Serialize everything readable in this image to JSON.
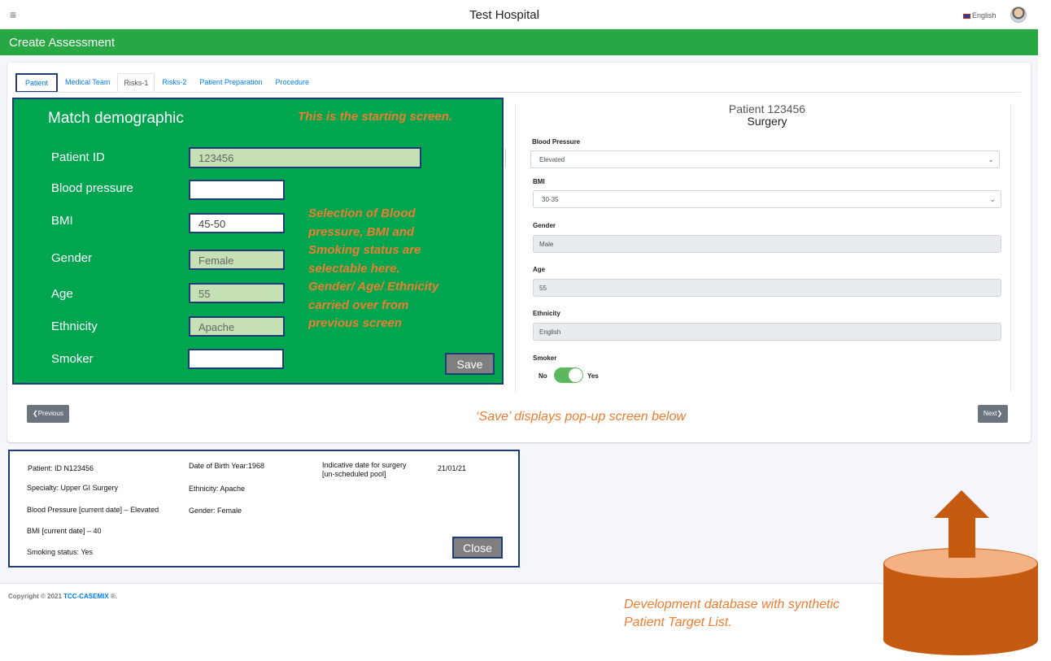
{
  "app": {
    "title": "Test Hospital",
    "language": "English",
    "page_header": "Create Assessment"
  },
  "tabs": [
    {
      "label": "Patient"
    },
    {
      "label": "Medical Team"
    },
    {
      "label": "Risks-1"
    },
    {
      "label": "Risks-2"
    },
    {
      "label": "Patient Preparation"
    },
    {
      "label": "Procedure"
    }
  ],
  "overlay_form": {
    "title": "Match demographic",
    "fields": {
      "patient_id": {
        "label": "Patient ID",
        "value": "123456"
      },
      "blood_pressure": {
        "label": "Blood pressure",
        "value": ""
      },
      "bmi": {
        "label": "BMI",
        "value": "45-50"
      },
      "gender": {
        "label": "Gender",
        "value": "Female"
      },
      "age": {
        "label": "Age",
        "value": "55"
      },
      "ethnicity": {
        "label": "Ethnicity",
        "value": "Apache"
      },
      "smoker": {
        "label": "Smoker",
        "value": ""
      }
    },
    "save_label": "Save"
  },
  "annotations": {
    "starting_screen": "This is the starting screen.",
    "selection_lines": [
      "Selection of Blood",
      "pressure, BMI and",
      "Smoking status are",
      "selectable here.",
      "Gender/ Age/ Ethnicity",
      "carried over from",
      "previous screen"
    ],
    "save_popup": "‘Save’ displays pop-up screen below",
    "database_lines": [
      "Development database with synthetic",
      "Patient Target List."
    ]
  },
  "right_panel": {
    "patient_title": "Patient 123456",
    "subtitle": "Surgery",
    "blood_pressure": {
      "label": "Blood Pressure",
      "value": "Elevated"
    },
    "bmi": {
      "label": "BMI",
      "value": "30-35"
    },
    "gender": {
      "label": "Gender",
      "value": "Male"
    },
    "age": {
      "label": "Age",
      "value": "55"
    },
    "ethnicity": {
      "label": "Ethnicity",
      "value": "English"
    },
    "smoker": {
      "label": "Smoker",
      "no_label": "No",
      "yes_label": "Yes",
      "on": true
    }
  },
  "navigation": {
    "previous_label": "Previous",
    "next_label": "Next"
  },
  "popup": {
    "patient_id": "Patient: ID N123456",
    "specialty": "Specialty: Upper GI Surgery",
    "blood_pressure": "Blood Pressure [current date] – Elevated",
    "bmi": "BMI [current date] – 40",
    "smoking": "Smoking status: Yes",
    "dob": "Date of Birth Year:1968",
    "ethnicity": "Ethnicity: Apache",
    "gender": "Gender: Female",
    "indicative_line1": "Indicative date for surgery",
    "indicative_line2": "[un-scheduled pool]",
    "indicative_date": "21/01/21",
    "close_label": "Close"
  },
  "footer": {
    "copyright": "Copyright © 2021 ",
    "brand": "TCC-CASEMIX",
    "suffix": " ®."
  },
  "colors": {
    "brand_green": "#28a745",
    "overlay_green": "#00a64f",
    "annotation_orange": "#ed7d31",
    "database_orange": "#c55a11"
  }
}
